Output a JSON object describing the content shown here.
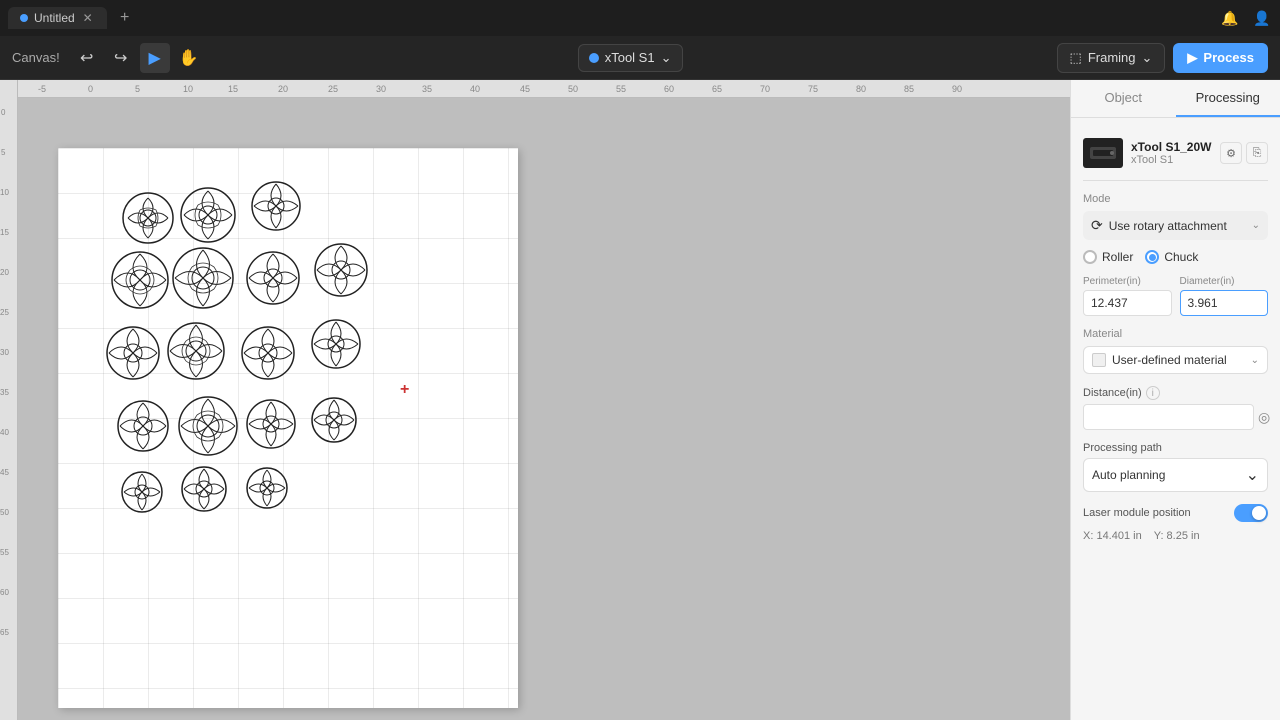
{
  "titlebar": {
    "tab_title": "Untitled",
    "tab_dot_color": "#4a9eff",
    "add_tab_label": "+",
    "bell_icon": "🔔",
    "user_icon": "👤"
  },
  "toolbar": {
    "canvas_label": "Canvas!",
    "undo_icon": "↩",
    "redo_icon": "↪",
    "play_icon": "▶",
    "hand_icon": "✋",
    "device_name": "xTool S1",
    "device_dot_color": "#4a9eff",
    "chevron_icon": "⌄",
    "framing_label": "Framing",
    "framing_icon": "⬚",
    "process_label": "Process",
    "process_icon": "▶"
  },
  "panel": {
    "tab_object": "Object",
    "tab_processing": "Processing",
    "active_tab": "Processing",
    "device": {
      "name": "xTool S1_20W",
      "sub": "xTool S1",
      "thumb_color": "#222"
    },
    "mode": {
      "label": "Mode",
      "icon": "⟳",
      "text": "Use rotary attachment",
      "chevron": "⌄"
    },
    "rotary_options": [
      {
        "id": "roller",
        "label": "Roller",
        "selected": false
      },
      {
        "id": "chuck",
        "label": "Chuck",
        "selected": true
      }
    ],
    "perimeter": {
      "label": "Perimeter(in)",
      "value": "12.437"
    },
    "diameter": {
      "label": "Diameter(in)",
      "value": "3.961",
      "focused": true
    },
    "material": {
      "label": "Material",
      "text": "User-defined material",
      "chevron": "⌄"
    },
    "distance": {
      "label": "Distance(in)",
      "value": "",
      "placeholder": ""
    },
    "processing_path": {
      "label": "Processing path",
      "value": "Auto planning",
      "chevron": "⌄"
    },
    "laser_module": {
      "label": "Laser module position",
      "enabled": true
    },
    "coords": {
      "x": "X: 14.401 in",
      "y": "Y: 8.25 in"
    }
  },
  "ruler": {
    "h_marks": [
      "-5",
      "0",
      "5",
      "10",
      "15",
      "20",
      "25"
    ],
    "v_marks": [
      "0",
      "5",
      "10",
      "15",
      "20"
    ]
  },
  "canvas": {
    "bg_color": "#c0c0c0",
    "paper_color": "#ffffff"
  }
}
